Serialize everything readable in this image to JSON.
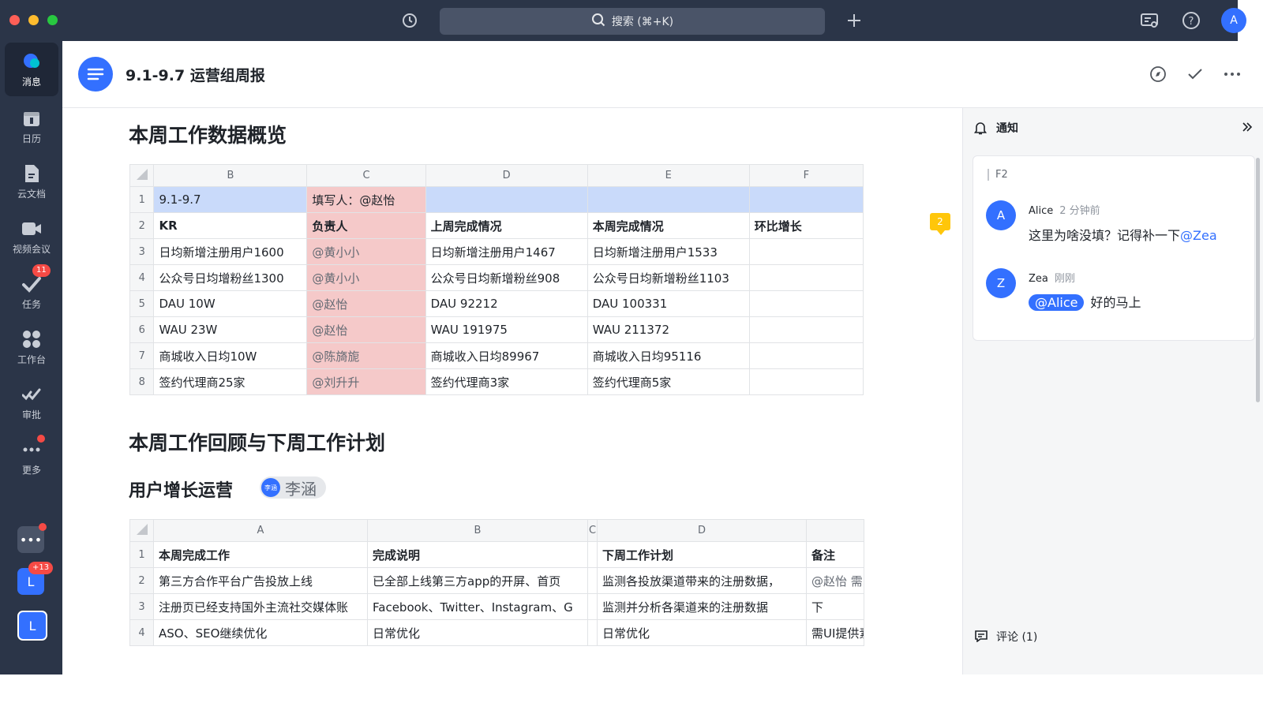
{
  "topbar": {
    "search_placeholder": "搜索 (⌘+K)",
    "avatar_letter": "A",
    "icons": [
      "history-icon",
      "search-icon",
      "plus-icon",
      "screen-share-icon",
      "help-icon"
    ]
  },
  "sidebar": {
    "items": [
      {
        "label": "消息",
        "icon": "message-icon",
        "active": true
      },
      {
        "label": "日历",
        "icon": "calendar-icon"
      },
      {
        "label": "云文档",
        "icon": "document-icon"
      },
      {
        "label": "视频会议",
        "icon": "video-icon"
      },
      {
        "label": "任务",
        "icon": "task-icon",
        "badge": "11"
      },
      {
        "label": "工作台",
        "icon": "apps-icon"
      },
      {
        "label": "审批",
        "icon": "approval-icon"
      },
      {
        "label": "更多",
        "icon": "more-icon"
      }
    ],
    "bottom_badge": "+13",
    "bottom_letters": [
      "L",
      "L"
    ]
  },
  "doc": {
    "title": "9.1-9.7 运营组周报",
    "section1_title": "本周工作数据概览",
    "section2_title": "本周工作回顾与下周工作计划",
    "section3_title": "用户增长运营",
    "chip_name": "李涵",
    "chip_avatar_text": "李涵",
    "comment_count_flag": "2"
  },
  "table1": {
    "columns": [
      "B",
      "C",
      "D",
      "E",
      "F"
    ],
    "rows": [
      {
        "n": "1",
        "cells": [
          "9.1-9.7",
          "填写人：@赵怡",
          "",
          "",
          ""
        ]
      },
      {
        "n": "2",
        "cells": [
          "KR",
          "负责人",
          "上周完成情况",
          "本周完成情况",
          "环比增长"
        ]
      },
      {
        "n": "3",
        "cells": [
          "日均新增注册用户1600",
          "@黄小小",
          "日均新增注册用户1467",
          "日均新增注册用户1533",
          ""
        ]
      },
      {
        "n": "4",
        "cells": [
          "公众号日均增粉丝1300",
          "@黄小小",
          "公众号日均新增粉丝908",
          "公众号日均新增粉丝1103",
          ""
        ]
      },
      {
        "n": "5",
        "cells": [
          "DAU 10W",
          "@赵怡",
          "DAU 92212",
          "DAU 100331",
          ""
        ]
      },
      {
        "n": "6",
        "cells": [
          "WAU 23W",
          "@赵怡",
          "WAU 191975",
          "WAU 211372",
          ""
        ]
      },
      {
        "n": "7",
        "cells": [
          "商城收入日均10W",
          "@陈旖旎",
          "商城收入日均89967",
          "商城收入日均95116",
          ""
        ]
      },
      {
        "n": "8",
        "cells": [
          "签约代理商25家",
          "@刘升升",
          "签约代理商3家",
          "签约代理商5家",
          ""
        ]
      }
    ]
  },
  "table2": {
    "columns": [
      "A",
      "B",
      "C",
      "D",
      ""
    ],
    "rows": [
      {
        "n": "1",
        "cells": [
          "本周完成工作",
          "完成说明",
          "",
          "下周工作计划",
          "备注"
        ]
      },
      {
        "n": "2",
        "cells": [
          "第三方合作平台广告投放上线",
          "已全部上线第三方app的开屏、首页",
          "",
          "监测各投放渠道带来的注册数据，",
          "@赵怡 需"
        ]
      },
      {
        "n": "3",
        "cells": [
          "注册页已经支持国外主流社交媒体账",
          "Facebook、Twitter、Instagram、G",
          "",
          "监测并分析各渠道来的注册数据",
          "下"
        ]
      },
      {
        "n": "4",
        "cells": [
          "ASO、SEO继续优化",
          "日常优化",
          "",
          "日常优化",
          "需UI提供素"
        ]
      }
    ]
  },
  "panel": {
    "title": "通知",
    "quote": "F2",
    "comments": [
      {
        "author": "Alice",
        "time": "2 分钟前",
        "avatar": "A",
        "text": "这里为啥没填？记得补一下",
        "mention": "@Zea"
      },
      {
        "author": "Zea",
        "time": "刚刚",
        "avatar": "Z",
        "mention": "@Alice",
        "text": "好的马上"
      }
    ],
    "footer": "评论 (1)"
  },
  "colors": {
    "accent": "#3370ff",
    "sidebar_bg": "#2b3548",
    "owner_cell": "#f5c9c9",
    "header_row": "#c9dafa",
    "flag": "#ffc60a"
  }
}
